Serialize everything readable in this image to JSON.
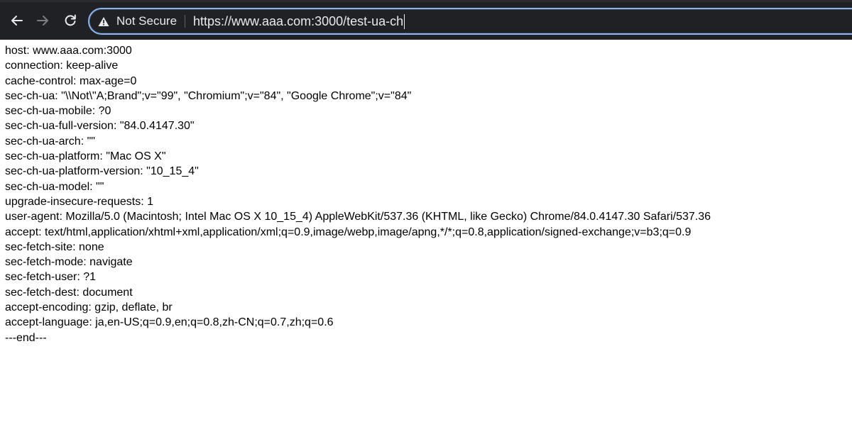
{
  "browser": {
    "security_label": "Not Secure",
    "url": "https://www.aaa.com:3000/test-ua-ch"
  },
  "page": {
    "lines": [
      "host: www.aaa.com:3000",
      "connection: keep-alive",
      "cache-control: max-age=0",
      "sec-ch-ua: \"\\\\Not\\\"A;Brand\";v=\"99\", \"Chromium\";v=\"84\", \"Google Chrome\";v=\"84\"",
      "sec-ch-ua-mobile: ?0",
      "sec-ch-ua-full-version: \"84.0.4147.30\"",
      "sec-ch-ua-arch: \"\"",
      "sec-ch-ua-platform: \"Mac OS X\"",
      "sec-ch-ua-platform-version: \"10_15_4\"",
      "sec-ch-ua-model: \"\"",
      "upgrade-insecure-requests: 1",
      "user-agent: Mozilla/5.0 (Macintosh; Intel Mac OS X 10_15_4) AppleWebKit/537.36 (KHTML, like Gecko) Chrome/84.0.4147.30 Safari/537.36",
      "accept: text/html,application/xhtml+xml,application/xml;q=0.9,image/webp,image/apng,*/*;q=0.8,application/signed-exchange;v=b3;q=0.9",
      "sec-fetch-site: none",
      "sec-fetch-mode: navigate",
      "sec-fetch-user: ?1",
      "sec-fetch-dest: document",
      "accept-encoding: gzip, deflate, br",
      "accept-language: ja,en-US;q=0.9,en;q=0.8,zh-CN;q=0.7,zh;q=0.6",
      "---end---"
    ]
  },
  "icons": {
    "back": "back-arrow-icon",
    "forward": "forward-arrow-icon",
    "reload": "reload-icon",
    "warning": "warning-icon"
  },
  "colors": {
    "toolbar_bg": "#202124",
    "omnibox_focus": "#8ab4f8",
    "toolbar_text": "#e8eaed",
    "page_bg": "#ffffff",
    "page_text": "#000000"
  }
}
